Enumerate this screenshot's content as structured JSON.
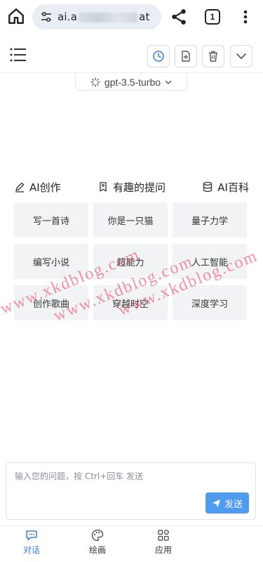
{
  "browser": {
    "url_prefix": "ai.a",
    "url_suffix": "at",
    "tab_count": "1"
  },
  "icons": {
    "home": "home-icon",
    "site_settings": "tune-icon",
    "share": "share-icon",
    "tabs": "tab-switcher-icon",
    "kebab": "more-vert-icon",
    "menu": "menu-icon",
    "history": "clock-icon",
    "new_chat": "file-plus-icon",
    "delete": "trash-icon",
    "more": "chevron-down-icon"
  },
  "model": {
    "label": "gpt-3.5-turbo"
  },
  "categories": [
    {
      "label": "AI创作",
      "icon": "pen-icon"
    },
    {
      "label": "有趣的提问",
      "icon": "tag-icon"
    },
    {
      "label": "AI百科",
      "icon": "database-icon"
    }
  ],
  "prompts": [
    "写一首诗",
    "你是一只猫",
    "量子力学",
    "编写小说",
    "超能力",
    "人工智能",
    "创作歌曲",
    "穿越时空",
    "深度学习"
  ],
  "watermark": "www.xkdblog.com",
  "input": {
    "placeholder": "输入您的问题，按 Ctrl+回车 发送",
    "send_label": "发送"
  },
  "nav": [
    {
      "label": "对话",
      "icon": "chat-icon",
      "active": true
    },
    {
      "label": "绘画",
      "icon": "palette-icon",
      "active": false
    },
    {
      "label": "应用",
      "icon": "apps-icon",
      "active": false
    }
  ],
  "colors": {
    "accent": "#3b82d8",
    "send_button": "#4f9bf0",
    "cell_bg": "#f2f3f5",
    "watermark": "#e63c5a"
  }
}
